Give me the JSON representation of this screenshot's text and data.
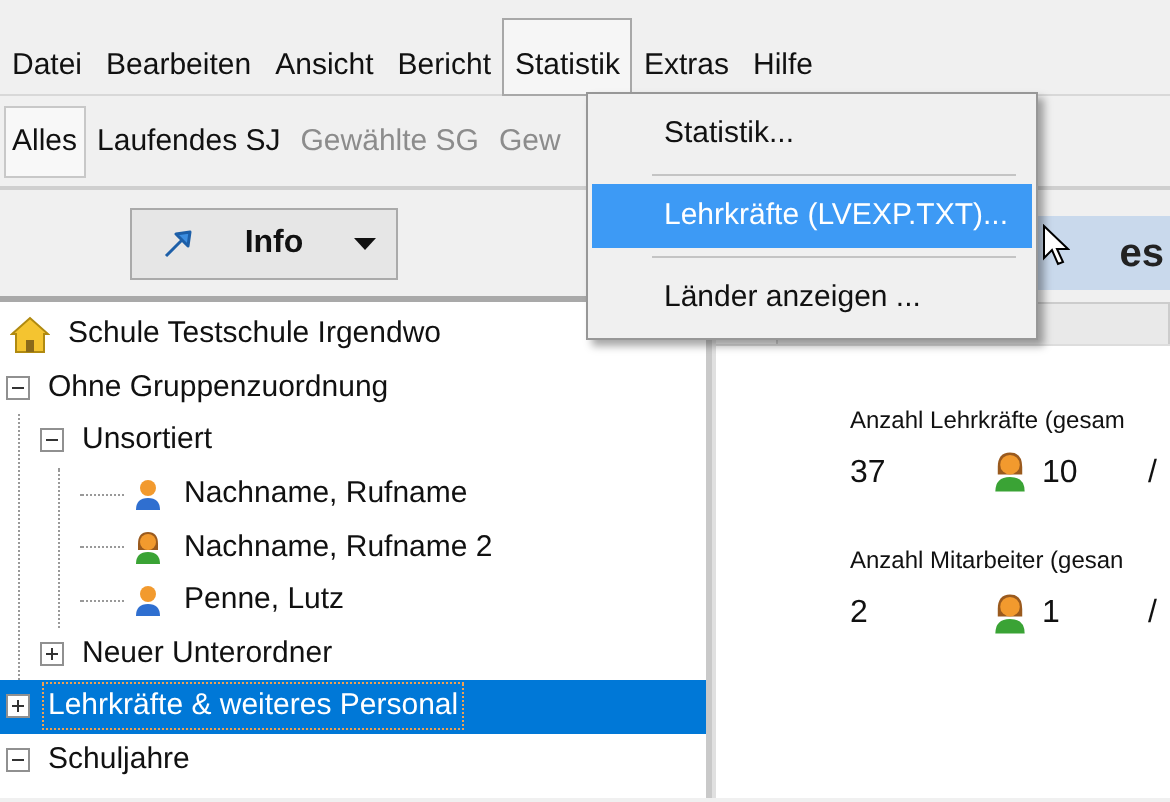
{
  "menu_bar": [
    {
      "label": "Datei",
      "selected": false
    },
    {
      "label": "Bearbeiten",
      "selected": false
    },
    {
      "label": "Ansicht",
      "selected": false
    },
    {
      "label": "Bericht",
      "selected": false
    },
    {
      "label": "Statistik",
      "selected": true
    },
    {
      "label": "Extras",
      "selected": false
    },
    {
      "label": "Hilfe",
      "selected": false
    }
  ],
  "filter_bar": [
    {
      "label": "Alles",
      "selected": true,
      "disabled": false
    },
    {
      "label": "Laufendes SJ",
      "selected": false,
      "disabled": false
    },
    {
      "label": "Gewählte SG",
      "selected": false,
      "disabled": true
    },
    {
      "label": "Gew",
      "selected": false,
      "disabled": true
    }
  ],
  "info_button": {
    "label": "Info"
  },
  "tree": [
    {
      "label": "Schule Testschule Irgendwo",
      "kind": "school",
      "selected": false
    },
    {
      "label": "Ohne Gruppenzuordnung",
      "kind": "folder",
      "expanded": true,
      "selected": false,
      "children": [
        {
          "label": "Unsortiert",
          "kind": "folder",
          "expanded": true,
          "selected": false,
          "children": [
            {
              "label": "Nachname, Rufname",
              "kind": "male",
              "selected": false
            },
            {
              "label": "Nachname, Rufname 2",
              "kind": "female",
              "selected": false
            },
            {
              "label": "Penne, Lutz",
              "kind": "male",
              "selected": false
            }
          ]
        },
        {
          "label": "Neuer Unterordner",
          "kind": "folder",
          "expanded": false,
          "selected": false
        }
      ]
    },
    {
      "label": "Lehrkräfte & weiteres Personal",
      "kind": "folder",
      "expanded": false,
      "selected": true
    },
    {
      "label": "Schuljahre",
      "kind": "folder",
      "expanded": true,
      "selected": false
    }
  ],
  "detail": {
    "header_title": "es",
    "stats": [
      {
        "label": "Anzahl Lehrkräfte (gesam",
        "total": "37",
        "female": "10",
        "column_3": "/"
      },
      {
        "label": "Anzahl Mitarbeiter (gesan",
        "total": "2",
        "female": "1",
        "column_3": "/"
      }
    ]
  },
  "dropdown_menu": [
    {
      "kind": "item",
      "label": "Statistik...",
      "selected": false
    },
    {
      "kind": "separator"
    },
    {
      "kind": "item",
      "label": "Lehrkräfte (LVEXP.TXT)...",
      "selected": true
    },
    {
      "kind": "separator"
    },
    {
      "kind": "item",
      "label": "Länder anzeigen ...",
      "selected": false
    }
  ]
}
